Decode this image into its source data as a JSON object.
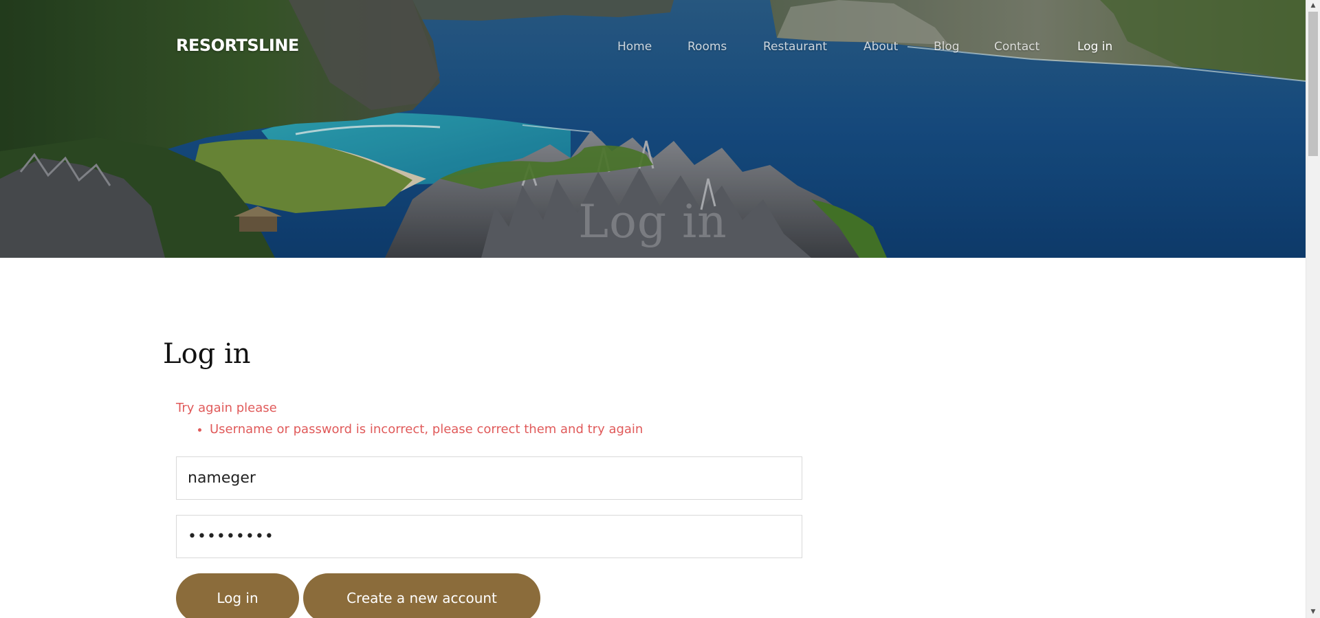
{
  "brand": "RESORTSLINE",
  "nav": {
    "items": [
      "Home",
      "Rooms",
      "Restaurant",
      "About",
      "Blog",
      "Contact",
      "Log in"
    ],
    "active_index": 6
  },
  "hero": {
    "title": "Log in",
    "image": "tropical-lagoon-limestone-cliffs-photo"
  },
  "login": {
    "title": "Log in",
    "error_heading": "Try again please",
    "error_items": [
      "Username or password is incorrect, please correct them and try again"
    ],
    "username_value": "nameger",
    "password_value": "•••••••••",
    "login_button": "Log in",
    "create_account_button": "Create a new account"
  },
  "colors": {
    "accent": "#8b6c3b",
    "error": "#e05a5a",
    "text": "#111111"
  },
  "icons": {
    "scroll_up": "arrow-up-icon",
    "scroll_down": "arrow-down-icon"
  }
}
